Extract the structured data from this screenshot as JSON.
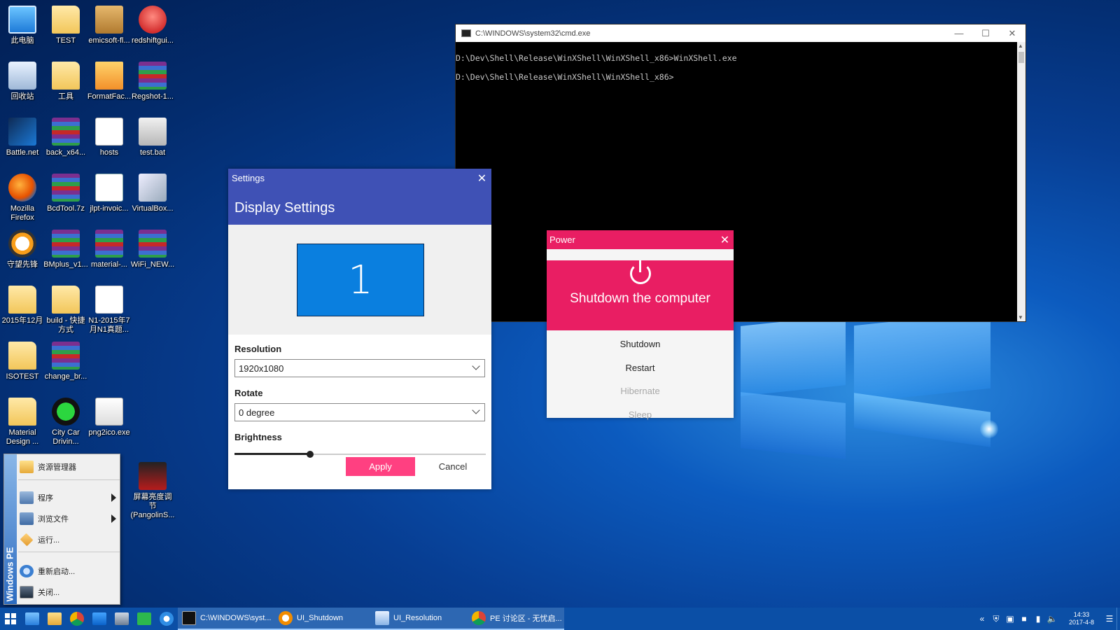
{
  "desktop": {
    "icons": [
      {
        "label": "此电脑",
        "icon": "this-pc-icon"
      },
      {
        "label": "TEST",
        "icon": "folder-icon"
      },
      {
        "label": "emicsoft-fl...",
        "icon": "installer-box-icon"
      },
      {
        "label": "redshiftgui...",
        "icon": "redshift-bulb-icon"
      },
      {
        "label": "回收站",
        "icon": "recycle-bin-icon"
      },
      {
        "label": "工具",
        "icon": "folder-icon"
      },
      {
        "label": "FormatFac...",
        "icon": "format-factory-icon"
      },
      {
        "label": "Regshot-1...",
        "icon": "winrar-archive-icon"
      },
      {
        "label": "Battle.net",
        "icon": "battlenet-icon"
      },
      {
        "label": "back_x64...",
        "icon": "winrar-archive-icon"
      },
      {
        "label": "hosts",
        "icon": "file-icon"
      },
      {
        "label": "test.bat",
        "icon": "batch-file-icon"
      },
      {
        "label": "Mozilla Firefox",
        "icon": "firefox-icon"
      },
      {
        "label": "BcdTool.7z",
        "icon": "winrar-archive-icon"
      },
      {
        "label": "jlpt-invoic...",
        "icon": "word-document-icon"
      },
      {
        "label": "VirtualBox...",
        "icon": "virtualbox-icon"
      },
      {
        "label": "守望先锋",
        "icon": "overwatch-icon"
      },
      {
        "label": "BMplus_v1...",
        "icon": "winrar-archive-icon"
      },
      {
        "label": "material-...",
        "icon": "winrar-archive-icon"
      },
      {
        "label": "WiFi_NEW...",
        "icon": "winrar-archive-icon"
      },
      {
        "label": "2015年12月",
        "icon": "folder-icon"
      },
      {
        "label": "build - 快捷方式",
        "icon": "folder-shortcut-icon"
      },
      {
        "label": "N1-2015年7月N1真题...",
        "icon": "pdf-icon"
      },
      {
        "label": "ISOTEST",
        "icon": "folder-icon"
      },
      {
        "label": "change_br...",
        "icon": "winrar-archive-icon"
      },
      {
        "label": "Material Design ...",
        "icon": "folder-icon"
      },
      {
        "label": "City Car Drivin...",
        "icon": "city-car-driving-icon"
      },
      {
        "label": "png2ico.exe",
        "icon": "png2ico-icon"
      },
      {
        "label": "屏幕亮度调节(PangolinS...",
        "icon": "pangolin-icon"
      }
    ]
  },
  "cmd_window": {
    "title": "C:\\WINDOWS\\system32\\cmd.exe",
    "lines": [
      "D:\\Dev\\Shell\\Release\\WinXShell\\WinXShell_x86>WinXShell.exe",
      "D:\\Dev\\Shell\\Release\\WinXShell\\WinXShell_x86>"
    ]
  },
  "settings_window": {
    "title": "Settings",
    "header": "Display Settings",
    "monitor_number": "1",
    "resolution_label": "Resolution",
    "resolution_value": "1920x1080",
    "rotate_label": "Rotate",
    "rotate_value": "0 degree",
    "brightness_label": "Brightness",
    "brightness_level": 0.3,
    "apply_label": "Apply",
    "cancel_label": "Cancel",
    "accent_color": "#3f51b5",
    "button_color": "#ff4081"
  },
  "power_window": {
    "title": "Power",
    "message": "Shutdown the computer",
    "items": [
      {
        "label": "Shutdown",
        "enabled": true
      },
      {
        "label": "Restart",
        "enabled": true
      },
      {
        "label": "Hibernate",
        "enabled": false
      },
      {
        "label": "Sleep",
        "enabled": false
      }
    ],
    "accent_color": "#e91e63"
  },
  "pe_menu": {
    "brand": "Windows PE",
    "items": [
      {
        "label": "资源管理器",
        "icon": "explorer-folder-icon",
        "submenu": false
      },
      {
        "label": "程序",
        "icon": "programs-icon",
        "submenu": true
      },
      {
        "label": "浏览文件",
        "icon": "browse-folder-icon",
        "submenu": true
      },
      {
        "label": "运行...",
        "icon": "run-icon",
        "submenu": false
      },
      {
        "label": "重新启动...",
        "icon": "restart-icon",
        "submenu": false
      },
      {
        "label": "关闭...",
        "icon": "shutdown-monitor-icon",
        "submenu": false
      }
    ]
  },
  "taskbar": {
    "pinned": [
      "task-view-icon",
      "file-explorer-icon",
      "chrome-icon",
      "desktop-icon",
      "control-panel-icon",
      "iqiyi-icon",
      "baidu-netdisk-icon"
    ],
    "tasks": [
      {
        "label": "C:\\WINDOWS\\syst...",
        "icon": "cmd-icon"
      },
      {
        "label": "UI_Shutdown",
        "icon": "power-app-icon"
      },
      {
        "label": "UI_Resolution",
        "icon": "resolution-app-icon"
      },
      {
        "label": "PE 讨论区 - 无忧启...",
        "icon": "chrome-icon"
      }
    ],
    "tray": {
      "time": "14:33",
      "date": "2017-4-8"
    }
  }
}
